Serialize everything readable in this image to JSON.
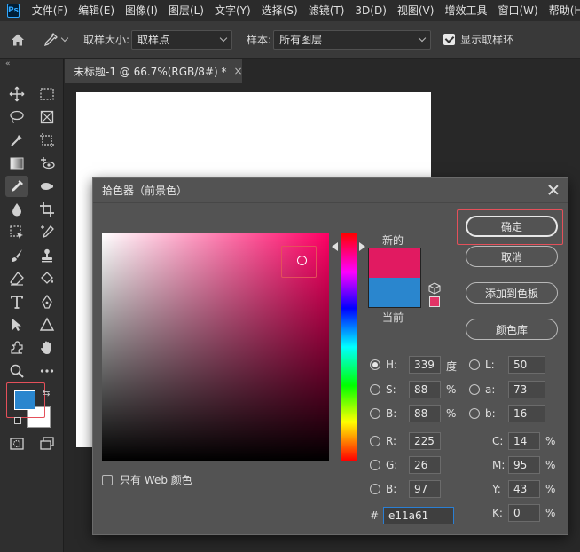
{
  "app": {
    "logo_text": "Ps",
    "menu": [
      "文件(F)",
      "编辑(E)",
      "图像(I)",
      "图层(L)",
      "文字(Y)",
      "选择(S)",
      "滤镜(T)",
      "3D(D)",
      "视图(V)",
      "增效工具",
      "窗口(W)",
      "帮助(H)"
    ]
  },
  "options_bar": {
    "sample_size_label": "取样大小:",
    "sample_size_value": "取样点",
    "sample_label": "样本:",
    "sample_value": "所有图层",
    "show_ring_label": "显示取样环",
    "show_ring_checked": true
  },
  "toolbar": {
    "collapse_label": "«",
    "foreground_color": "#2a86ce",
    "background_color": "#ffffff"
  },
  "document": {
    "tab_title": "未标题-1 @ 66.7%(RGB/8#) *",
    "close_label": "×"
  },
  "dialog": {
    "title": "拾色器（前景色）",
    "new_label": "新的",
    "current_label": "当前",
    "new_color": "#e11a61",
    "current_color": "#2a86ce",
    "buttons": {
      "ok": "确定",
      "cancel": "取消",
      "add_to_swatches": "添加到色板",
      "color_libraries": "颜色库"
    },
    "fields": {
      "H": {
        "label": "H:",
        "value": "339",
        "unit": "度"
      },
      "S": {
        "label": "S:",
        "value": "88",
        "unit": "%"
      },
      "B": {
        "label": "B:",
        "value": "88",
        "unit": "%"
      },
      "R": {
        "label": "R:",
        "value": "225"
      },
      "G": {
        "label": "G:",
        "value": "26"
      },
      "Bl": {
        "label": "B:",
        "value": "97"
      },
      "L": {
        "label": "L:",
        "value": "50"
      },
      "a": {
        "label": "a:",
        "value": "73"
      },
      "b": {
        "label": "b:",
        "value": "16"
      },
      "C": {
        "label": "C:",
        "value": "14",
        "unit": "%"
      },
      "M": {
        "label": "M:",
        "value": "95",
        "unit": "%"
      },
      "Y": {
        "label": "Y:",
        "value": "43",
        "unit": "%"
      },
      "K": {
        "label": "K:",
        "value": "0",
        "unit": "%"
      }
    },
    "hex_label": "#",
    "hex_value": "e11a61",
    "web_only_label": "只有 Web 颜色"
  }
}
